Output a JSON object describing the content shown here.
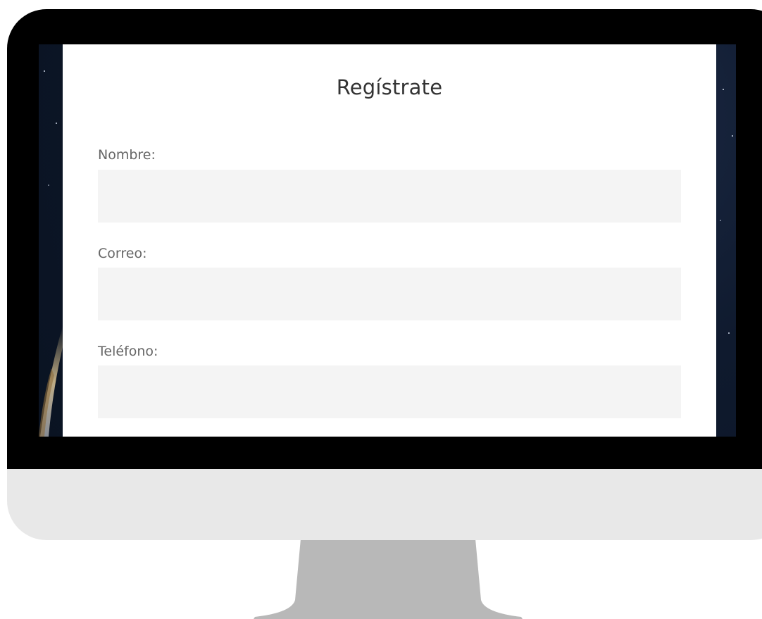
{
  "form": {
    "title": "Regístrate",
    "fields": [
      {
        "label": "Nombre:",
        "value": "",
        "placeholder": ""
      },
      {
        "label": "Correo:",
        "value": "",
        "placeholder": ""
      },
      {
        "label": "Teléfono:",
        "value": "",
        "placeholder": ""
      }
    ]
  },
  "colors": {
    "bezel": "#000000",
    "chin": "#e8e8e8",
    "stand": "#b8b8b8",
    "input_bg": "#f4f4f4",
    "screen_bg": "#0f1a2e"
  }
}
